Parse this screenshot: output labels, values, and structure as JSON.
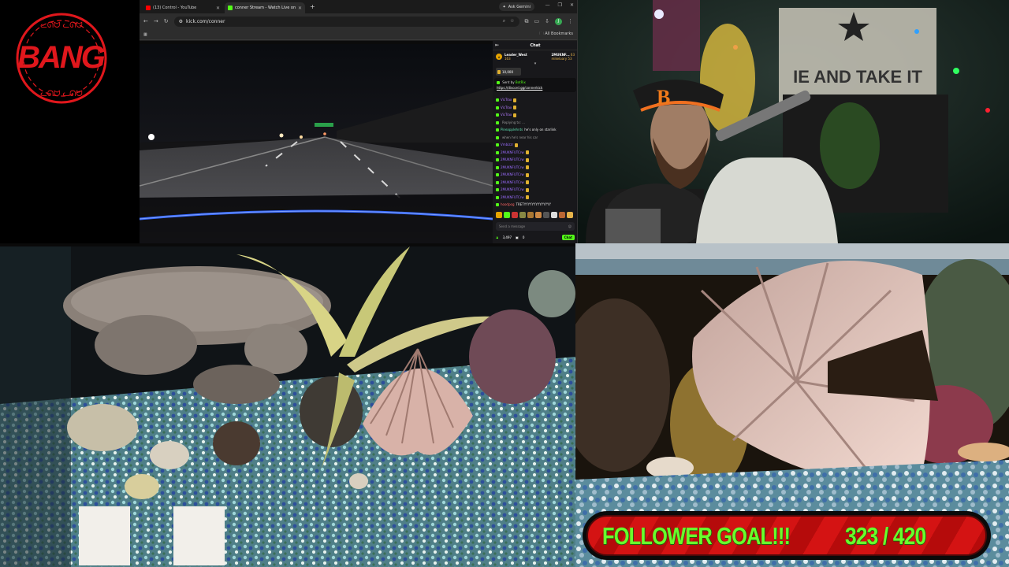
{
  "overlay": {
    "logo_text": "BANG",
    "logo_arc_top": "ᓚᘏᗢ ᓚᘏᗢ",
    "logo_arc_bottom": "ᓚᘏᗢ ᓚᘏᗢ",
    "logo_color": "#e0171c"
  },
  "browser": {
    "tabs": [
      {
        "label": "(13) Control - YouTube",
        "favicon_color": "#ff0000",
        "active": false
      },
      {
        "label": "conner Stream - Watch Live on",
        "favicon_color": "#53fc18",
        "active": true
      }
    ],
    "new_tab": "+",
    "gemini_label": "Ask Gemini",
    "url": "kick.com/conner",
    "bookmarks_label": "All Bookmarks"
  },
  "chat": {
    "header": "Chat",
    "leaders": [
      {
        "name": "Leader_West",
        "count": "63",
        "sub": "163"
      },
      {
        "name": "2MUKNF...",
        "count": "63",
        "sub": ""
      },
      {
        "name": "mikeloary",
        "count": "53",
        "sub": ""
      }
    ],
    "goal_chip": "10,000",
    "pinned_by": "Sent by",
    "pinned_user": "BotRix",
    "pinned_link": "https://discord.gg/connerkick",
    "messages": [
      {
        "user": "VicTrax",
        "text": "",
        "color": "purple",
        "emote": true
      },
      {
        "user": "VicTrax",
        "text": "",
        "color": "purple",
        "emote": true
      },
      {
        "user": "VicTrax",
        "text": "",
        "color": "purple",
        "emote": true
      },
      {
        "user": "",
        "text": "Replying to: ...",
        "color": "gray",
        "emote": false
      },
      {
        "user": "Pineapplehnts",
        "text": "he's only on starlink",
        "color": "teal",
        "emote": false
      },
      {
        "user": "",
        "text": "when he's near his car",
        "color": "gray",
        "emote": false
      },
      {
        "user": "Vmbizzr",
        "text": "",
        "color": "violet",
        "emote": true
      },
      {
        "user": "2MUKNFUTCrw",
        "text": "",
        "color": "violet",
        "emote": true
      },
      {
        "user": "2MUKNFUTCrw",
        "text": "",
        "color": "violet",
        "emote": true
      },
      {
        "user": "2MUKNFUTCrw",
        "text": "",
        "color": "violet",
        "emote": true
      },
      {
        "user": "2MUKNFUTCrw",
        "text": "",
        "color": "violet",
        "emote": true
      },
      {
        "user": "2MUKNFUTCrw",
        "text": "",
        "color": "violet",
        "emote": true
      },
      {
        "user": "2MUKNFUTCrw",
        "text": "",
        "color": "violet",
        "emote": true
      },
      {
        "user": "2MUKNFUTCrw",
        "text": "",
        "color": "violet",
        "emote": true
      },
      {
        "user": "hoodpog",
        "text": "TRETYYYYYYYYYYYYYY",
        "color": "red",
        "emote": false
      }
    ],
    "input_placeholder": "Send a message",
    "viewer_count": "3,497",
    "points": "0",
    "chat_button": "Chat"
  },
  "goal": {
    "label": "FOLLOWER GOAL!!!",
    "current": "323",
    "separator": "/",
    "target": "420",
    "progress": 0.769,
    "text_color": "#69ff2c",
    "bar_color": "#d41313"
  }
}
